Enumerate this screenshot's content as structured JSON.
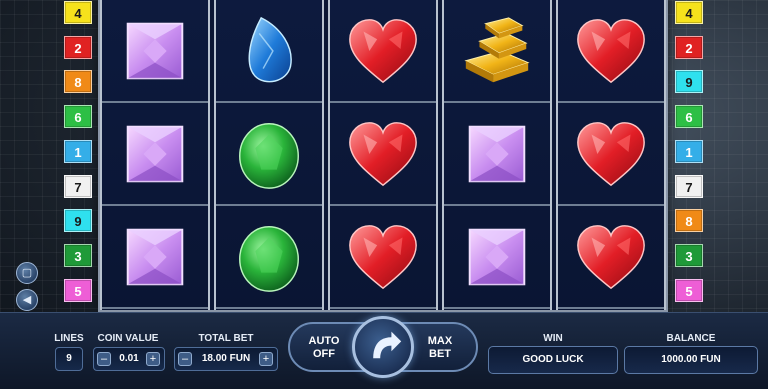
{
  "left_lines": [
    "4",
    "2",
    "8",
    "6",
    "1",
    "7",
    "9",
    "3",
    "5"
  ],
  "right_lines": [
    "4",
    "2",
    "9",
    "6",
    "1",
    "7",
    "8",
    "3",
    "5"
  ],
  "line_colors": {
    "1": "#34aee8",
    "2": "#e02222",
    "3": "#1f9a38",
    "4": "#f6e21c",
    "5": "#ee5ed6",
    "6": "#2dbf45",
    "7": "#f1f1f1",
    "8": "#f08a17",
    "9": "#2fe0ee"
  },
  "reels": [
    [
      "pink-gem",
      "pink-gem",
      "pink-gem"
    ],
    [
      "blue-gem",
      "green-gem",
      "green-gem"
    ],
    [
      "red-heart",
      "red-heart",
      "red-heart"
    ],
    [
      "gold-bars",
      "pink-gem",
      "pink-gem"
    ],
    [
      "red-heart",
      "red-heart",
      "red-heart"
    ]
  ],
  "side_buttons": [
    "settings-icon",
    "sound-icon",
    "info-icon",
    "minus-icon"
  ],
  "controls": {
    "lines_label": "LINES",
    "lines_value": "9",
    "coin_value_label": "COIN VALUE",
    "coin_value": "0.01",
    "total_bet_label": "TOTAL BET",
    "total_bet": "18.00 FUN",
    "auto_line1": "AUTO",
    "auto_line2": "OFF",
    "max_line1": "MAX",
    "max_line2": "BET",
    "win_label": "WIN",
    "win_value": "GOOD LUCK",
    "balance_label": "BALANCE",
    "balance_value": "1000.00 FUN",
    "minus": "–",
    "plus": "+"
  }
}
